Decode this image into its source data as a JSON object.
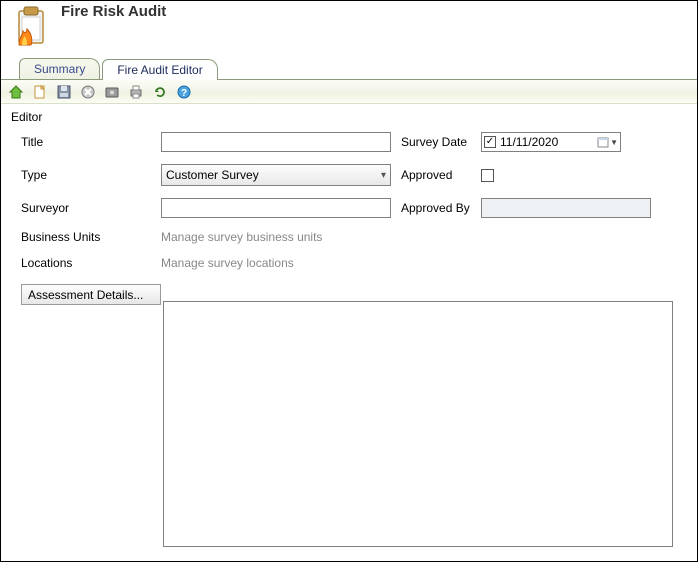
{
  "header": {
    "title": "Fire Risk Audit"
  },
  "tabs": [
    {
      "label": "Summary",
      "active": false
    },
    {
      "label": "Fire Audit Editor",
      "active": true
    }
  ],
  "toolbar": {
    "icons": [
      "home-icon",
      "new-icon",
      "save-icon",
      "cancel-icon",
      "settings-icon",
      "print-icon",
      "refresh-icon",
      "help-icon"
    ]
  },
  "editor": {
    "section_label": "Editor",
    "labels": {
      "title": "Title",
      "type": "Type",
      "surveyor": "Surveyor",
      "business_units": "Business Units",
      "locations": "Locations",
      "survey_date": "Survey Date",
      "approved": "Approved",
      "approved_by": "Approved By",
      "assessment_details": "Assessment Details..."
    },
    "values": {
      "title": "",
      "type": "Customer Survey",
      "surveyor": "",
      "business_units_link": "Manage survey business units",
      "locations_link": "Manage survey locations",
      "survey_date": "11/11/2020",
      "survey_date_checked": true,
      "approved": false,
      "approved_by": ""
    }
  }
}
